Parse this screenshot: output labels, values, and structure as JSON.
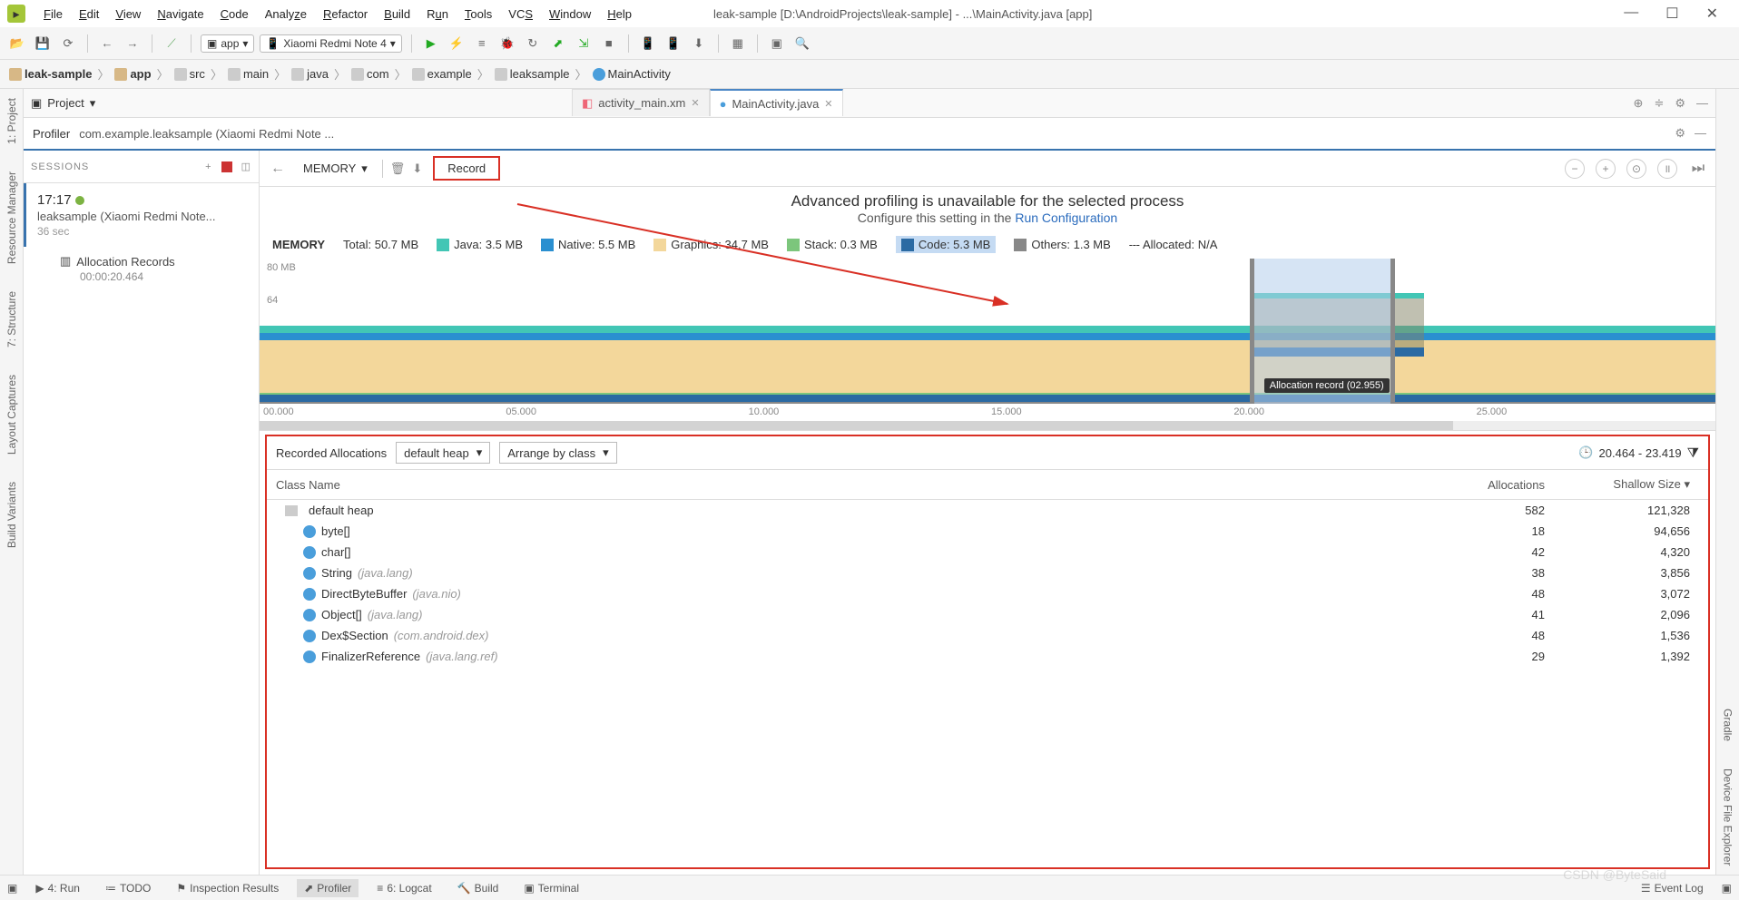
{
  "menu": {
    "items": [
      "File",
      "Edit",
      "View",
      "Navigate",
      "Code",
      "Analyze",
      "Refactor",
      "Build",
      "Run",
      "Tools",
      "VCS",
      "Window",
      "Help"
    ],
    "title": "leak-sample [D:\\AndroidProjects\\leak-sample] - ...\\MainActivity.java [app]"
  },
  "toolbar": {
    "app": "app",
    "device": "Xiaomi Redmi Note 4"
  },
  "breadcrumb": [
    "leak-sample",
    "app",
    "src",
    "main",
    "java",
    "com",
    "example",
    "leaksample",
    "MainActivity"
  ],
  "editor_tabs": [
    {
      "label": "activity_main.xm"
    },
    {
      "label": "MainActivity.java"
    }
  ],
  "project_panel": {
    "title": "Project"
  },
  "profiler": {
    "title": "Profiler",
    "process": "com.example.leaksample (Xiaomi Redmi Note ...",
    "sessions_label": "SESSIONS",
    "session": {
      "time": "17:17",
      "proc": "leaksample (Xiaomi Redmi Note...",
      "duration": "36 sec"
    },
    "alloc_rec": {
      "label": "Allocation Records",
      "ts": "00:00:20.464"
    },
    "memory_label": "MEMORY",
    "record_label": "Record",
    "adv_msg": "Advanced profiling is unavailable for the selected process",
    "adv_config": "Configure this setting in the ",
    "adv_link": "Run Configuration",
    "legend": {
      "header": "MEMORY",
      "total": "Total: 50.7 MB",
      "java": "Java: 3.5 MB",
      "native": "Native: 5.5 MB",
      "graphics": "Graphics: 34.7 MB",
      "stack": "Stack: 0.3 MB",
      "code": "Code: 5.3 MB",
      "others": "Others: 1.3 MB",
      "allocated": "Allocated: N/A"
    },
    "selection_label": "Allocation record (02.955)",
    "recorded_title": "Recorded Allocations",
    "heap_combo": "default heap",
    "arrange_combo": "Arrange by class",
    "time_range": "20.464 - 23.419",
    "cols": {
      "class": "Class Name",
      "alloc": "Allocations",
      "shallow": "Shallow Size"
    },
    "rows": [
      {
        "name": "default heap",
        "pkg": "",
        "alloc": "582",
        "shallow": "121,328",
        "folder": true
      },
      {
        "name": "byte[]",
        "pkg": "",
        "alloc": "18",
        "shallow": "94,656"
      },
      {
        "name": "char[]",
        "pkg": "",
        "alloc": "42",
        "shallow": "4,320"
      },
      {
        "name": "String",
        "pkg": "(java.lang)",
        "alloc": "38",
        "shallow": "3,856"
      },
      {
        "name": "DirectByteBuffer",
        "pkg": "(java.nio)",
        "alloc": "48",
        "shallow": "3,072"
      },
      {
        "name": "Object[]",
        "pkg": "(java.lang)",
        "alloc": "41",
        "shallow": "2,096"
      },
      {
        "name": "Dex$Section",
        "pkg": "(com.android.dex)",
        "alloc": "48",
        "shallow": "1,536"
      },
      {
        "name": "FinalizerReference",
        "pkg": "(java.lang.ref)",
        "alloc": "29",
        "shallow": "1,392"
      }
    ]
  },
  "left_rail": [
    "1: Project",
    "Resource Manager",
    "7: Structure",
    "Layout Captures",
    "Build Variants"
  ],
  "right_rail": [
    "Gradle",
    "Device File Explorer"
  ],
  "bottom_tabs": [
    "4: Run",
    "TODO",
    "Inspection Results",
    "Profiler",
    "6: Logcat",
    "Build",
    "Terminal"
  ],
  "bottom_right": "Event Log",
  "chart_data": {
    "type": "area",
    "ylabel": "MB",
    "ylim": [
      0,
      80
    ],
    "y_ticks": [
      "80 MB",
      "64",
      "48",
      "32",
      "16"
    ],
    "x_ticks": [
      "00.000",
      "05.000",
      "10.000",
      "15.000",
      "20.000",
      "25.000"
    ],
    "series": [
      {
        "name": "Java",
        "value_mb": 3.5,
        "color": "#42c6b5"
      },
      {
        "name": "Native",
        "value_mb": 5.5,
        "color": "#2a8fd0"
      },
      {
        "name": "Graphics",
        "value_mb": 34.7,
        "color": "#f3d79b"
      },
      {
        "name": "Stack",
        "value_mb": 0.3,
        "color": "#7cc67c"
      },
      {
        "name": "Code",
        "value_mb": 5.3,
        "color": "#2b6aa3"
      },
      {
        "name": "Others",
        "value_mb": 1.3,
        "color": "#888888"
      }
    ],
    "total_mb": 50.7,
    "selection": {
      "start_s": 20.464,
      "end_s": 23.419,
      "label": "Allocation record (02.955)"
    }
  },
  "watermark": "CSDN @ByteSaid"
}
